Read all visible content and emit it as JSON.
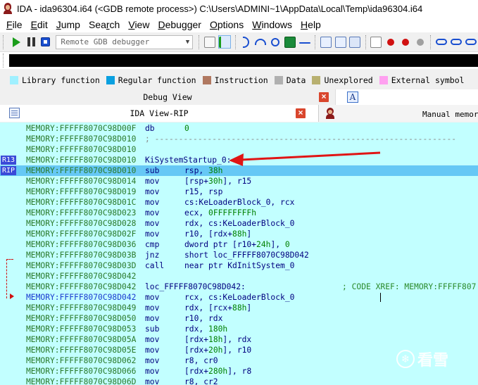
{
  "window": {
    "title": "IDA - ida96304.i64 (<GDB remote process>) C:\\Users\\ADMINI~1\\AppData\\Local\\Temp\\ida96304.i64"
  },
  "menu": {
    "items": [
      {
        "label": "File",
        "underline": "F"
      },
      {
        "label": "Edit",
        "underline": "E"
      },
      {
        "label": "Jump",
        "underline": "J"
      },
      {
        "label": "Search",
        "underline": "r"
      },
      {
        "label": "View",
        "underline": "V"
      },
      {
        "label": "Debugger",
        "underline": "D"
      },
      {
        "label": "Options",
        "underline": "O"
      },
      {
        "label": "Windows",
        "underline": "W"
      },
      {
        "label": "Help",
        "underline": "H"
      }
    ]
  },
  "toolbar": {
    "debugger_select": "Remote GDB debugger"
  },
  "legend": {
    "items": [
      {
        "label": "Library function",
        "color": "#a0f0ff"
      },
      {
        "label": "Regular function",
        "color": "#0aa0e0"
      },
      {
        "label": "Instruction",
        "color": "#b07860"
      },
      {
        "label": "Data",
        "color": "#b0b0b0"
      },
      {
        "label": "Unexplored",
        "color": "#b8b070"
      },
      {
        "label": "External symbol",
        "color": "#ffa0f0"
      }
    ]
  },
  "tabs": {
    "debug_view": "Debug View",
    "ida_view": "IDA View-RIP",
    "manual_memory": "Manual memor"
  },
  "registers": {
    "r13": "R13",
    "rip": "RIP"
  },
  "disassembly": [
    {
      "addr": "MEMORY:FFFFF8070C98D00F",
      "mnem": "db",
      "ops": "0"
    },
    {
      "addr": "MEMORY:FFFFF8070C98D010",
      "sep": "; ---------------------------------------------------------------"
    },
    {
      "addr": "MEMORY:FFFFF8070C98D010"
    },
    {
      "addr": "MEMORY:FFFFF8070C98D010",
      "label": "KiSystemStartup_0:"
    },
    {
      "addr": "MEMORY:FFFFF8070C98D010",
      "mnem": "sub",
      "ops": "rsp, 38h",
      "hl": true
    },
    {
      "addr": "MEMORY:FFFFF8070C98D014",
      "mnem": "mov",
      "ops": "[rsp+30h], r15"
    },
    {
      "addr": "MEMORY:FFFFF8070C98D019",
      "mnem": "mov",
      "ops": "r15, rsp"
    },
    {
      "addr": "MEMORY:FFFFF8070C98D01C",
      "mnem": "mov",
      "ops": "cs:KeLoaderBlock_0, rcx"
    },
    {
      "addr": "MEMORY:FFFFF8070C98D023",
      "mnem": "mov",
      "ops": "ecx, 0FFFFFFFFh"
    },
    {
      "addr": "MEMORY:FFFFF8070C98D028",
      "mnem": "mov",
      "ops": "rdx, cs:KeLoaderBlock_0"
    },
    {
      "addr": "MEMORY:FFFFF8070C98D02F",
      "mnem": "mov",
      "ops": "r10, [rdx+88h]"
    },
    {
      "addr": "MEMORY:FFFFF8070C98D036",
      "mnem": "cmp",
      "ops": "dword ptr [r10+24h], 0"
    },
    {
      "addr": "MEMORY:FFFFF8070C98D03B",
      "mnem": "jnz",
      "ops": "short loc_FFFFF8070C98D042"
    },
    {
      "addr": "MEMORY:FFFFF8070C98D03D",
      "mnem": "call",
      "ops": "near ptr KdInitSystem_0"
    },
    {
      "addr": "MEMORY:FFFFF8070C98D042"
    },
    {
      "addr": "MEMORY:FFFFF8070C98D042",
      "label": "loc_FFFFF8070C98D042:",
      "comment": "; CODE XREF: MEMORY:FFFFF807"
    },
    {
      "addr": "MEMORY:FFFFF8070C98D042",
      "mnem": "mov",
      "ops": "rcx, cs:KeLoaderBlock_0",
      "blue": true
    },
    {
      "addr": "MEMORY:FFFFF8070C98D049",
      "mnem": "mov",
      "ops": "rdx, [rcx+88h]"
    },
    {
      "addr": "MEMORY:FFFFF8070C98D050",
      "mnem": "mov",
      "ops": "r10, rdx"
    },
    {
      "addr": "MEMORY:FFFFF8070C98D053",
      "mnem": "sub",
      "ops": "rdx, 180h"
    },
    {
      "addr": "MEMORY:FFFFF8070C98D05A",
      "mnem": "mov",
      "ops": "[rdx+18h], rdx"
    },
    {
      "addr": "MEMORY:FFFFF8070C98D05E",
      "mnem": "mov",
      "ops": "[rdx+20h], r10"
    },
    {
      "addr": "MEMORY:FFFFF8070C98D062",
      "mnem": "mov",
      "ops": "r8, cr0"
    },
    {
      "addr": "MEMORY:FFFFF8070C98D066",
      "mnem": "mov",
      "ops": "[rdx+280h], r8"
    },
    {
      "addr": "MEMORY:FFFFF8070C98D06D",
      "mnem": "mov",
      "ops": "r8, cr2"
    }
  ],
  "watermark": "看雪"
}
